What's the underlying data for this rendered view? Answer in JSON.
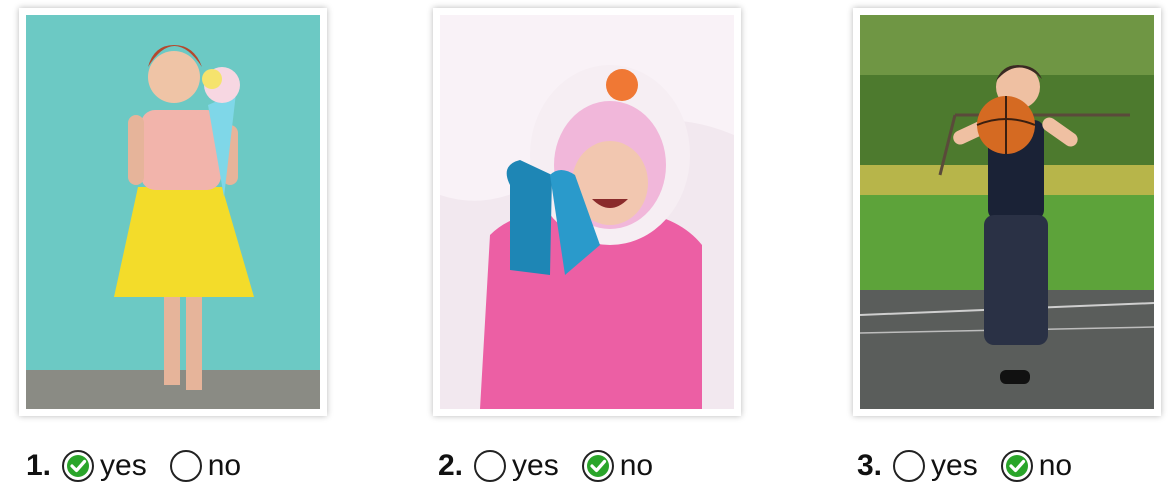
{
  "items": [
    {
      "number": "1.",
      "yes_label": "yes",
      "no_label": "no",
      "selected": "yes",
      "photo_icon": "girl-in-yellow-skirt-with-ice-cream-icon"
    },
    {
      "number": "2.",
      "yes_label": "yes",
      "no_label": "no",
      "selected": "no",
      "photo_icon": "child-in-pink-snow-jacket-icon"
    },
    {
      "number": "3.",
      "yes_label": "yes",
      "no_label": "no",
      "selected": "no",
      "photo_icon": "boy-playing-basketball-icon"
    }
  ],
  "colors": {
    "check": "#2aa52a",
    "circle_stroke": "#222222"
  }
}
